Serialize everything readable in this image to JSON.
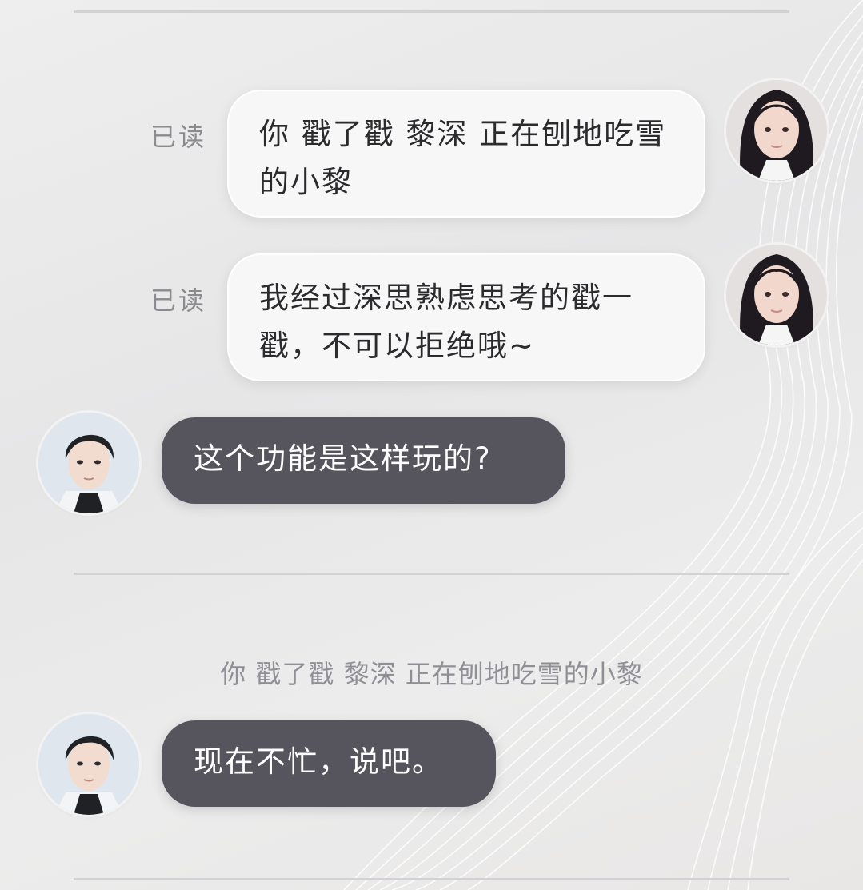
{
  "chat": {
    "messages": [
      {
        "sender": "self",
        "status": "已读",
        "text": "你 戳了戳 黎深 正在刨地吃雪的小黎"
      },
      {
        "sender": "self",
        "status": "已读",
        "text": "我经过深思熟虑思考的戳一戳，不可以拒绝哦~"
      },
      {
        "sender": "other",
        "text": "这个功能是这样玩的?"
      }
    ],
    "system_notice": "你 戳了戳 黎深 正在刨地吃雪的小黎",
    "reply": {
      "sender": "other",
      "text": "现在不忙，说吧。"
    }
  },
  "colors": {
    "dark_bubble": "#56555e",
    "light_bubble": "#f7f7f8",
    "read_label": "#8a8a8f"
  },
  "icons": {
    "self_avatar": "female-avatar-icon",
    "other_avatar": "male-avatar-icon"
  }
}
